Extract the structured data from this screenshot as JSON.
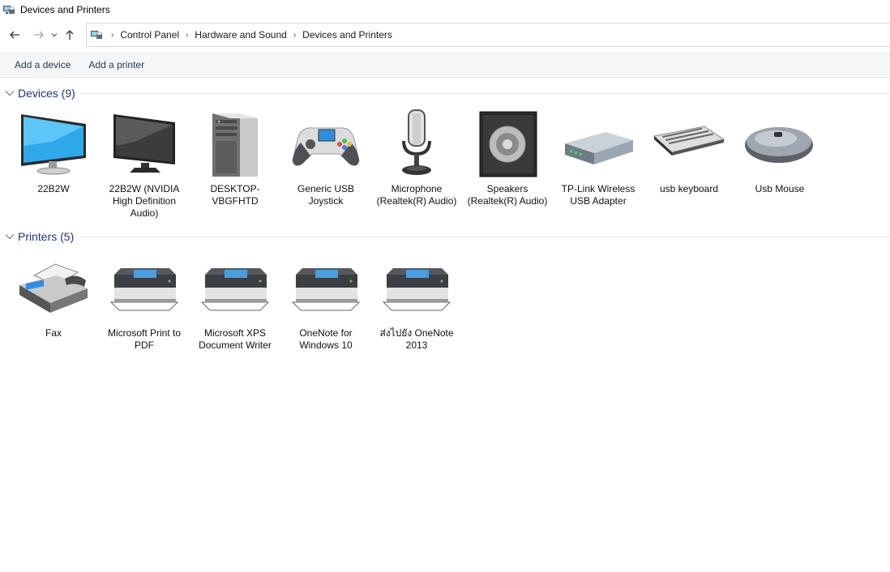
{
  "window": {
    "title": "Devices and Printers"
  },
  "navigation": {
    "breadcrumbs": [
      "Control Panel",
      "Hardware and Sound",
      "Devices and Printers"
    ]
  },
  "commands": {
    "add_device": "Add a device",
    "add_printer": "Add a printer"
  },
  "groups": {
    "devices": {
      "title": "Devices (9)",
      "items": [
        {
          "label": "22B2W",
          "icon": "monitor-icon"
        },
        {
          "label": "22B2W (NVIDIA High Definition Audio)",
          "icon": "monitor-dark-icon"
        },
        {
          "label": "DESKTOP-VBGFHTD",
          "icon": "computer-tower-icon"
        },
        {
          "label": "Generic   USB Joystick",
          "icon": "gamepad-icon"
        },
        {
          "label": "Microphone (Realtek(R) Audio)",
          "icon": "microphone-icon"
        },
        {
          "label": "Speakers (Realtek(R) Audio)",
          "icon": "speaker-icon"
        },
        {
          "label": "TP-Link Wireless USB Adapter",
          "icon": "network-adapter-icon"
        },
        {
          "label": "usb keyboard",
          "icon": "keyboard-icon"
        },
        {
          "label": "Usb Mouse",
          "icon": "mouse-icon"
        }
      ]
    },
    "printers": {
      "title": "Printers (5)",
      "items": [
        {
          "label": "Fax",
          "icon": "fax-icon"
        },
        {
          "label": "Microsoft Print to PDF",
          "icon": "printer-icon"
        },
        {
          "label": "Microsoft XPS Document Writer",
          "icon": "printer-icon"
        },
        {
          "label": "OneNote for Windows 10",
          "icon": "printer-icon"
        },
        {
          "label": "ส่งไปยัง OneNote 2013",
          "icon": "printer-icon"
        }
      ]
    }
  }
}
